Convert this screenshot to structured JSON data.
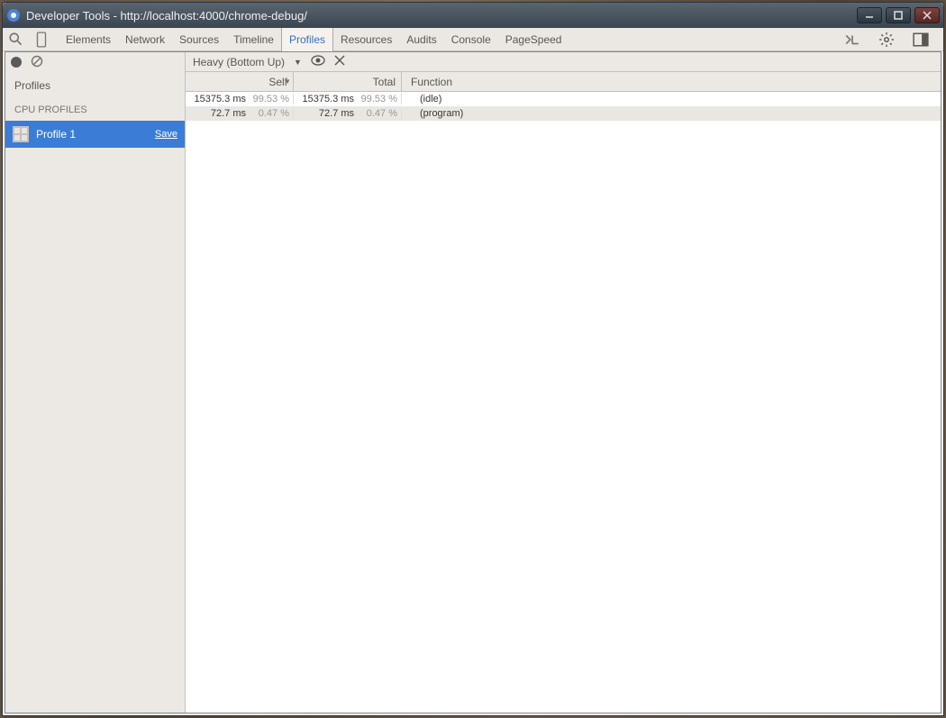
{
  "window": {
    "title": "Developer Tools - http://localhost:4000/chrome-debug/"
  },
  "toolbar": {
    "tabs": [
      "Elements",
      "Network",
      "Sources",
      "Timeline",
      "Profiles",
      "Resources",
      "Audits",
      "Console",
      "PageSpeed"
    ],
    "active_tab": "Profiles"
  },
  "sidebar": {
    "profiles_label": "Profiles",
    "cpu_heading": "CPU PROFILES",
    "item": {
      "name": "Profile 1",
      "save": "Save"
    }
  },
  "profile_toolbar": {
    "view_mode": "Heavy (Bottom Up)"
  },
  "table": {
    "columns": {
      "self": "Self",
      "total": "Total",
      "function": "Function"
    },
    "rows": [
      {
        "self_time": "15375.3 ms",
        "self_pct": "99.53 %",
        "total_time": "15375.3 ms",
        "total_pct": "99.53 %",
        "function": "(idle)"
      },
      {
        "self_time": "72.7 ms",
        "self_pct": "0.47 %",
        "total_time": "72.7 ms",
        "total_pct": "0.47 %",
        "function": "(program)"
      }
    ]
  }
}
